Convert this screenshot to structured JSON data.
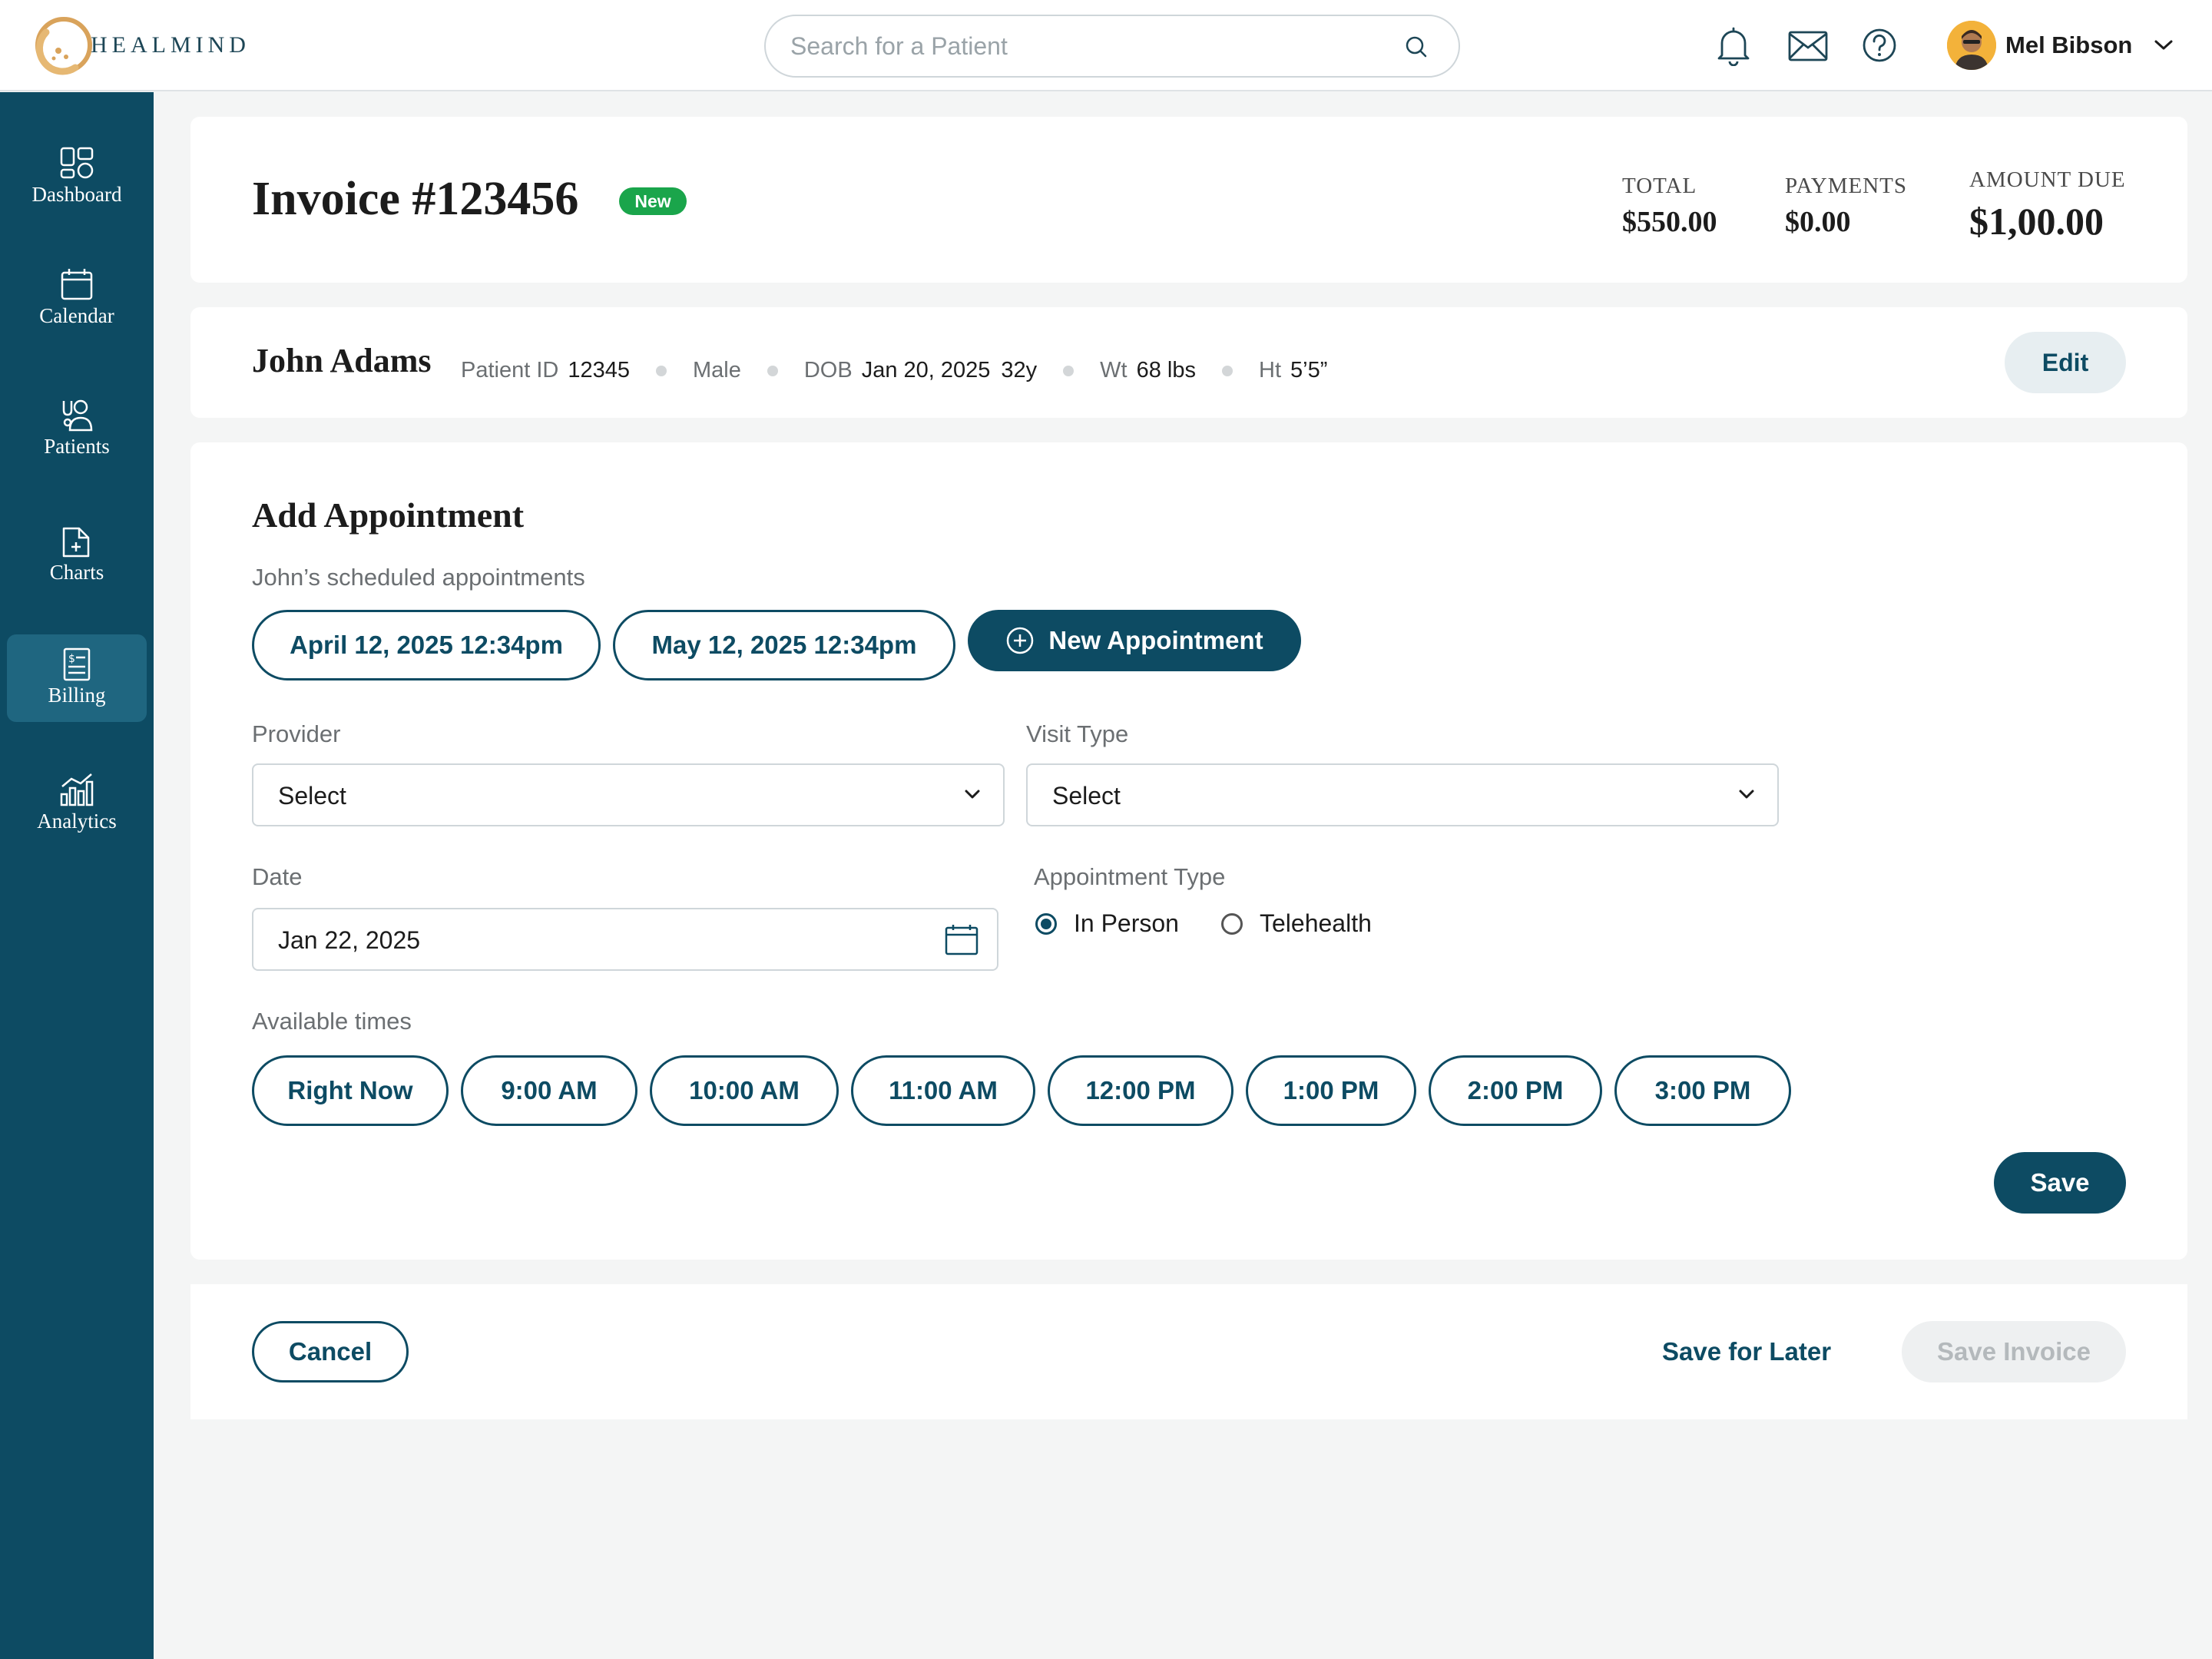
{
  "app": {
    "logo_text": "HEALMIND"
  },
  "search": {
    "placeholder": "Search for a Patient"
  },
  "user": {
    "name": "Mel Bibson"
  },
  "sidebar": {
    "items": [
      {
        "label": "Dashboard",
        "icon": "dashboard-icon"
      },
      {
        "label": "Calendar",
        "icon": "calendar-icon"
      },
      {
        "label": "Patients",
        "icon": "patients-icon"
      },
      {
        "label": "Charts",
        "icon": "charts-icon"
      },
      {
        "label": "Billing",
        "icon": "billing-icon",
        "active": true
      },
      {
        "label": "Analytics",
        "icon": "analytics-icon"
      }
    ]
  },
  "invoice": {
    "title": "Invoice #123456",
    "badge": "New",
    "total_label": "TOTAL",
    "total_value": "$550.00",
    "payments_label": "PAYMENTS",
    "payments_value": "$0.00",
    "due_label": "AMOUNT DUE",
    "due_value": "$1,00.00"
  },
  "patient": {
    "name": "John Adams",
    "id_label": "Patient ID",
    "id_value": "12345",
    "sex": "Male",
    "dob_label": "DOB",
    "dob_value": "Jan 20, 2025",
    "age": "32y",
    "wt_label": "Wt",
    "wt_value": "68 lbs",
    "ht_label": "Ht",
    "ht_value": "5’5”",
    "edit_label": "Edit"
  },
  "appointment": {
    "title": "Add Appointment",
    "scheduled_label": "John’s scheduled appointments",
    "scheduled": [
      "April 12, 2025 12:34pm",
      "May 12, 2025 12:34pm"
    ],
    "new_label": "New Appointment",
    "provider_label": "Provider",
    "provider_value": "Select",
    "visit_type_label": "Visit Type",
    "visit_type_value": "Select",
    "date_label": "Date",
    "date_value": "Jan 22, 2025",
    "appt_type_label": "Appointment Type",
    "appt_types": [
      {
        "label": "In Person",
        "selected": true
      },
      {
        "label": "Telehealth",
        "selected": false
      }
    ],
    "times_label": "Available times",
    "times": [
      "Right Now",
      "9:00 AM",
      "10:00 AM",
      "11:00 AM",
      "12:00 PM",
      "1:00 PM",
      "2:00 PM",
      "3:00 PM"
    ],
    "save_label": "Save"
  },
  "footer": {
    "cancel_label": "Cancel",
    "save_later_label": "Save for Later",
    "save_invoice_label": "Save Invoice"
  },
  "colors": {
    "primary": "#0d4b63",
    "sidebar_active": "#1f6680",
    "badge_green": "#1aa54b",
    "background": "#f4f5f5"
  }
}
